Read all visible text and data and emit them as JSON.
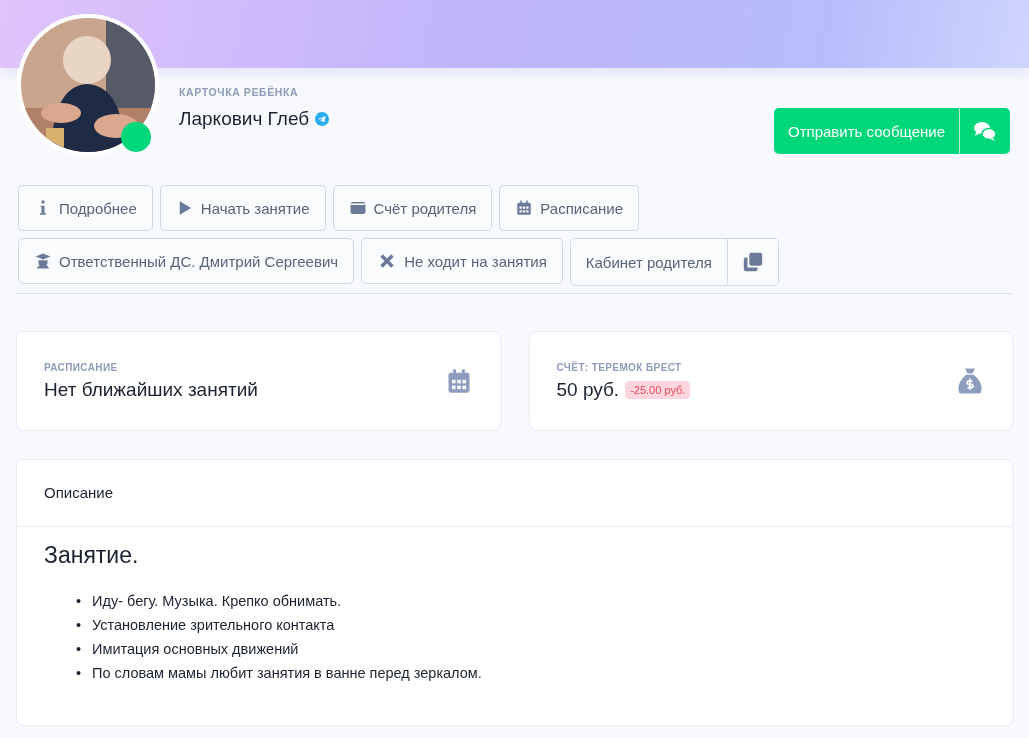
{
  "profile": {
    "kind": "picture",
    "online": true,
    "caption": "КАРТОЧКА РЕБЁНКА",
    "name": "Ларкович Глеб",
    "telegram": true
  },
  "send_button": {
    "label": "Отправить сообщение"
  },
  "action_rows": [
    [
      "Подробнее",
      "Начать занятие",
      "Счёт родителя",
      "Расписание"
    ],
    [
      "Ответственный ДС. Дмитрий Сергеевич",
      "Не ходит на занятия",
      "Кабинет родителя"
    ]
  ],
  "cards": [
    {
      "kind": "schedule",
      "caption": "РАСПИСАНИЕ",
      "value": "Нет ближайших занятий"
    },
    {
      "kind": "account",
      "caption": "СЧЁТ: ТЕРЕМОК БРЕСТ",
      "value": "50 руб.",
      "badge": "-25.00 руб."
    }
  ],
  "description": {
    "title": "Описание",
    "heading": "Занятие.",
    "items": [
      {
        "bullet": "•",
        "text": "Иду- бегу. Музыка. Крепко обнимать."
      },
      {
        "bullet": "•",
        "text": "Установление зрительного контакта"
      },
      {
        "bullet": "•",
        "text": "Имитация основных движений"
      },
      {
        "bullet": "•",
        "text": "По словам мамы любит занятия в ванне перед зеркалом."
      }
    ]
  }
}
